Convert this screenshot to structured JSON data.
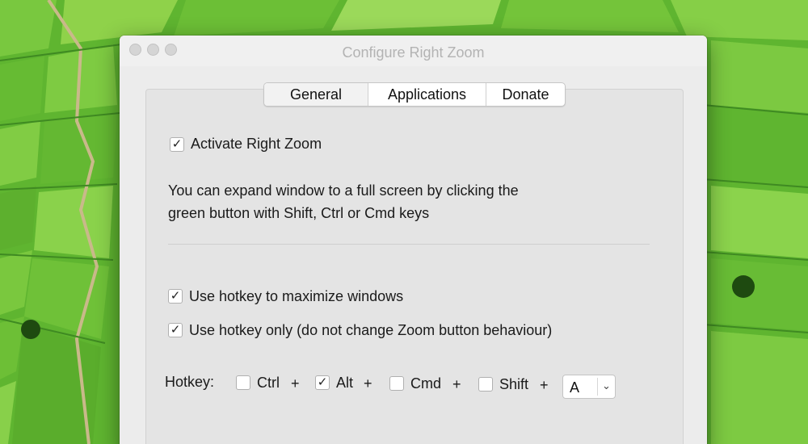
{
  "window": {
    "title": "Configure Right Zoom"
  },
  "tabs": [
    {
      "label": "General",
      "selected": true
    },
    {
      "label": "Applications",
      "selected": false
    },
    {
      "label": "Donate",
      "selected": false
    }
  ],
  "general": {
    "activate": {
      "label": "Activate Right Zoom",
      "checked": true
    },
    "description_line1": "You can expand window to a full screen by clicking the",
    "description_line2": "green button with Shift, Ctrl or Cmd keys",
    "use_hotkey": {
      "label": "Use hotkey to maximize windows",
      "checked": true
    },
    "hotkey_only": {
      "label": "Use hotkey only (do not change Zoom button behaviour)",
      "checked": true
    }
  },
  "hotkey": {
    "label": "Hotkey:",
    "modifiers": [
      {
        "label": "Ctrl",
        "checked": false
      },
      {
        "label": "Alt",
        "checked": true
      },
      {
        "label": "Cmd",
        "checked": false
      },
      {
        "label": "Shift",
        "checked": false
      }
    ],
    "plus": "+",
    "key_value": "A",
    "checkmark": "✓"
  },
  "icons": {
    "chevron": "⌄"
  },
  "colors": {
    "background_green": "#6fbf3a",
    "window_bg": "#ececec"
  }
}
